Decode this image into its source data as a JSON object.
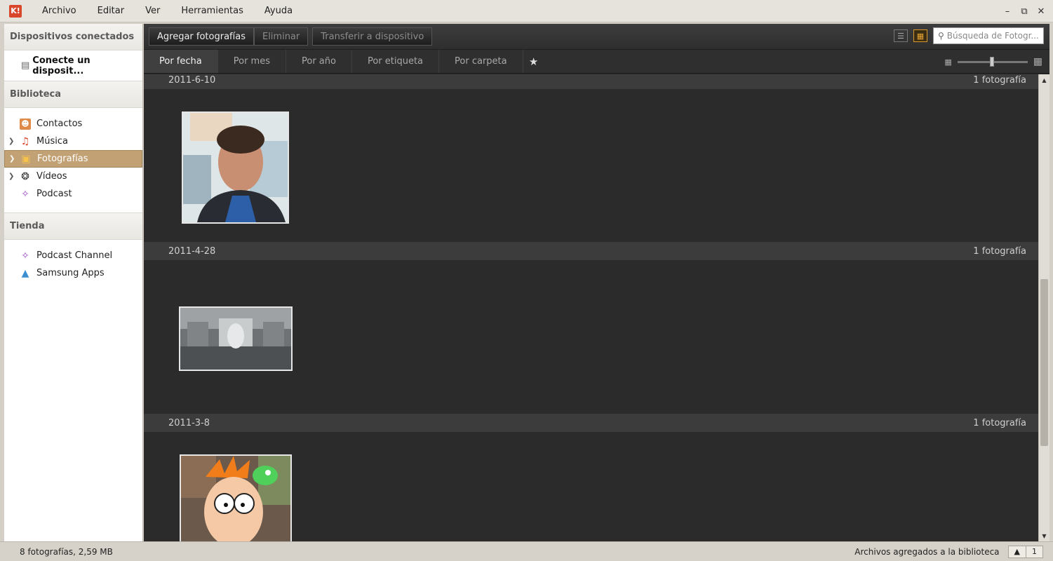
{
  "app": {
    "logo_text": "K!",
    "menu": [
      "Archivo",
      "Editar",
      "Ver",
      "Herramientas",
      "Ayuda"
    ]
  },
  "sidebar": {
    "devices_header": "Dispositivos conectados",
    "device_connect": "Conecte un disposit...",
    "library_header": "Biblioteca",
    "library_items": [
      {
        "label": "Contactos",
        "icon": "contacts-icon"
      },
      {
        "label": "Música",
        "icon": "music-icon"
      },
      {
        "label": "Fotografías",
        "icon": "photos-icon"
      },
      {
        "label": "Vídeos",
        "icon": "videos-icon"
      },
      {
        "label": "Podcast",
        "icon": "podcast-icon"
      }
    ],
    "store_header": "Tienda",
    "store_items": [
      {
        "label": "Podcast Channel",
        "icon": "podcast-icon"
      },
      {
        "label": "Samsung Apps",
        "icon": "apps-icon"
      }
    ]
  },
  "toolbar": {
    "add_photos": "Agregar fotografías",
    "delete": "Eliminar",
    "transfer": "Transferir a dispositivo",
    "search_placeholder": "Búsqueda de Fotogr..."
  },
  "tabs": [
    "Por fecha",
    "Por mes",
    "Por año",
    "Por etiqueta",
    "Por carpeta"
  ],
  "groups": [
    {
      "date": "2011-6-10",
      "count": "1 fotografía"
    },
    {
      "date": "2011-4-28",
      "count": "1 fotografía"
    },
    {
      "date": "2011-3-8",
      "count": "1 fotografía"
    }
  ],
  "status": {
    "summary": "8 fotografías, 2,59 MB",
    "message": "Archivos agregados a la biblioteca",
    "page": "1"
  },
  "colors": {
    "selected_sidebar": "#c2a174",
    "active_view_icon": "#e8a431",
    "content_bg": "#2b2b2b"
  }
}
